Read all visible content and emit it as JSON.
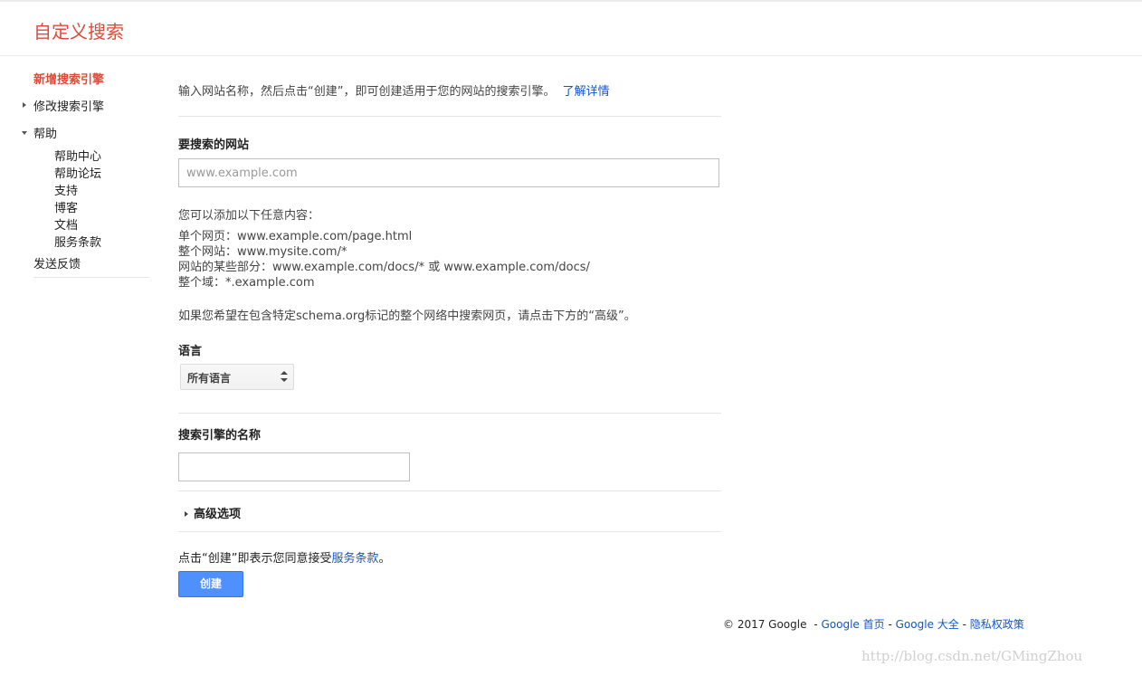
{
  "header": {
    "title": "自定义搜索"
  },
  "sidebar": {
    "new_engine": "新增搜索引擎",
    "edit_engine": "修改搜索引擎",
    "help": "帮助",
    "help_items": [
      "帮助中心",
      "帮助论坛",
      "支持",
      "博客",
      "文档",
      "服务条款"
    ],
    "feedback": "发送反馈"
  },
  "main": {
    "intro_text": "输入网站名称，然后点击“创建”，即可创建适用于您的网站的搜索引擎。",
    "learn_more": "了解详情",
    "sites_label": "要搜索的网站",
    "sites_placeholder": "www.example.com",
    "can_add": "您可以添加以下任意内容：",
    "examples": [
      "单个网页：www.example.com/page.html",
      "整个网站：www.mysite.com/*",
      "网站的某些部分：www.example.com/docs/* 或 www.example.com/docs/",
      "整个域：*.example.com"
    ],
    "schema_note": "如果您希望在包含特定schema.org标记的整个网络中搜索网页，请点击下方的“高级”。",
    "language_label": "语言",
    "language_value": "所有语言",
    "name_label": "搜索引擎的名称",
    "name_value": "",
    "advanced_label": "高级选项",
    "terms_prefix": "点击“创建”即表示您同意接受",
    "terms_link": "服务条款",
    "terms_suffix": "。",
    "create_button": "创建"
  },
  "footer": {
    "copyright": "© 2017 Google",
    "sep1": "-",
    "home": "Google 首页",
    "sep2": "-",
    "all": "Google 大全",
    "sep3": "-",
    "privacy": "隐私权政策"
  },
  "watermark": "http://blog.csdn.net/GMingZhou",
  "colors": {
    "brand_red": "#dd4b39",
    "link_blue": "#1155cc",
    "button_blue": "#4d90fe"
  }
}
